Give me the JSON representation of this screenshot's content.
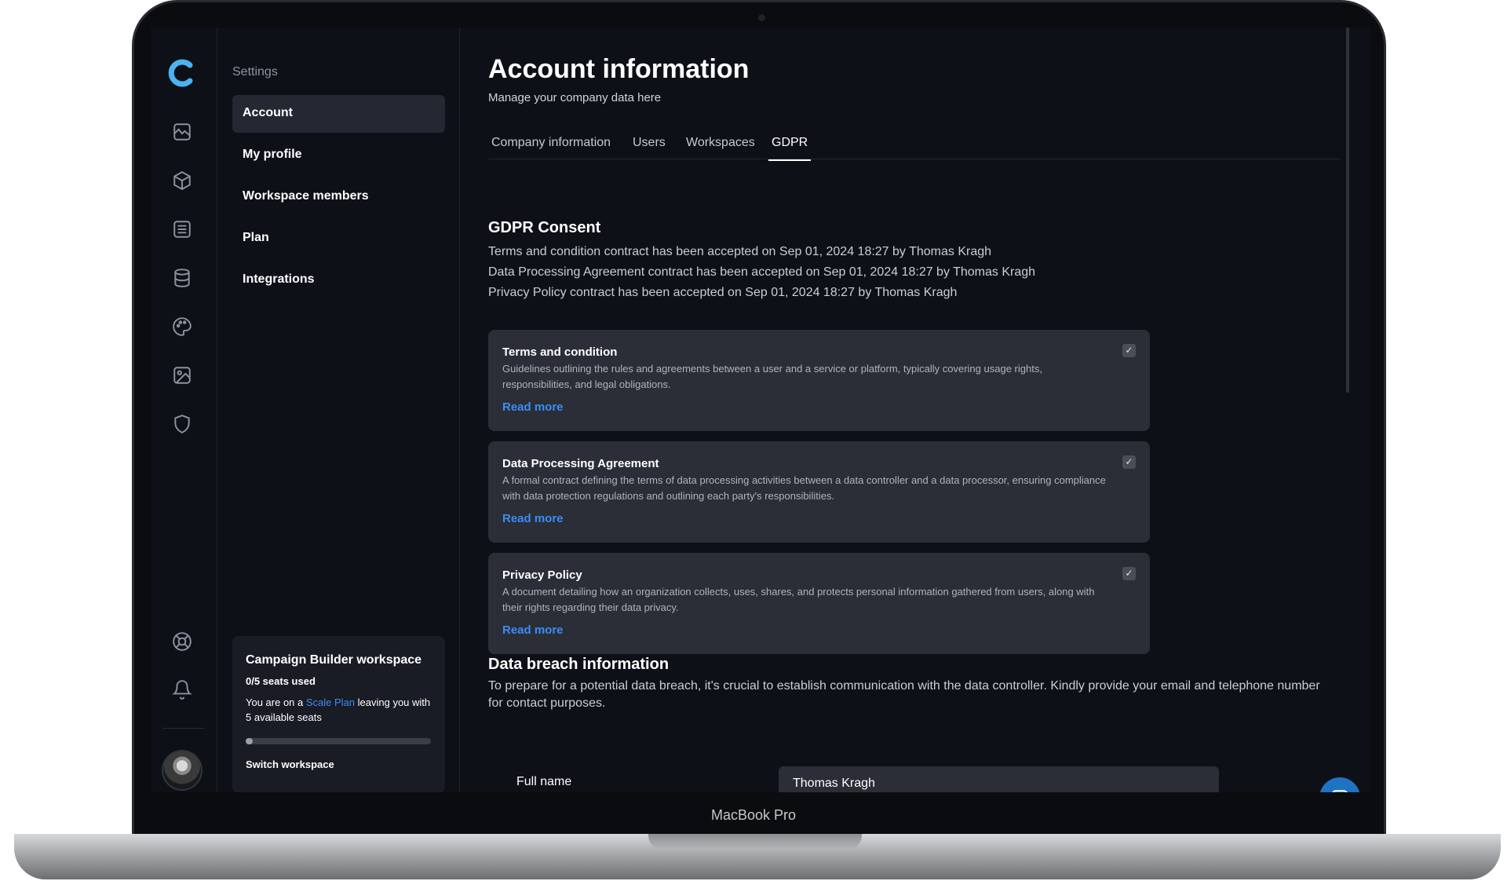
{
  "device": {
    "label": "MacBook Pro"
  },
  "rail": {
    "icons": [
      "logo-icon",
      "analytics-icon",
      "box-icon",
      "list-icon",
      "database-icon",
      "palette-icon",
      "image-icon",
      "shield-icon",
      "help-icon",
      "bell-icon"
    ]
  },
  "settings": {
    "title": "Settings",
    "items": [
      {
        "label": "Account",
        "active": true
      },
      {
        "label": "My profile"
      },
      {
        "label": "Workspace members"
      },
      {
        "label": "Plan"
      },
      {
        "label": "Integrations"
      }
    ]
  },
  "workspace": {
    "name": "Campaign Builder workspace",
    "seats": "0/5 seats used",
    "plan_prefix": "You are on a ",
    "plan_link": "Scale Plan",
    "plan_suffix": " leaving you with 5 available seats",
    "progress": 0.03,
    "switch_label": "Switch workspace"
  },
  "page": {
    "title": "Account information",
    "subtitle": "Manage your company data here",
    "tabs": [
      "Company information",
      "Users",
      "Workspaces",
      "GDPR"
    ],
    "active_tab": "GDPR"
  },
  "gdpr": {
    "title": "GDPR Consent",
    "lines": [
      "Terms and condition contract has been accepted on Sep 01, 2024 18:27 by Thomas Kragh",
      "Data Processing Agreement contract has been accepted on Sep 01, 2024 18:27 by Thomas Kragh",
      "Privacy Policy contract has been accepted on Sep 01, 2024 18:27 by Thomas Kragh"
    ],
    "cards": [
      {
        "title": "Terms and condition",
        "desc": "Guidelines outlining the rules and agreements between a user and a service or platform, typically covering usage rights, responsibilities, and legal obligations.",
        "link": "Read more",
        "checked": true
      },
      {
        "title": "Data Processing Agreement",
        "desc": "A formal contract defining the terms of data processing activities between a data controller and a data processor, ensuring compliance with data protection regulations and outlining each party's responsibilities.",
        "link": "Read more",
        "checked": true
      },
      {
        "title": "Privacy Policy",
        "desc": "A document detailing how an organization collects, uses, shares, and protects personal information gathered from users, along with their rights regarding their data privacy.",
        "link": "Read more",
        "checked": true
      }
    ]
  },
  "breach": {
    "title": "Data breach information",
    "desc": "To prepare for a potential data breach, it's crucial to establish communication with the data controller. Kindly provide your email and telephone number for contact purposes.",
    "full_name_label": "Full name",
    "full_name_value": "Thomas Kragh"
  },
  "colors": {
    "accent": "#3b8cf5",
    "logo": "#4db3f0",
    "chat": "#1f73c4"
  }
}
